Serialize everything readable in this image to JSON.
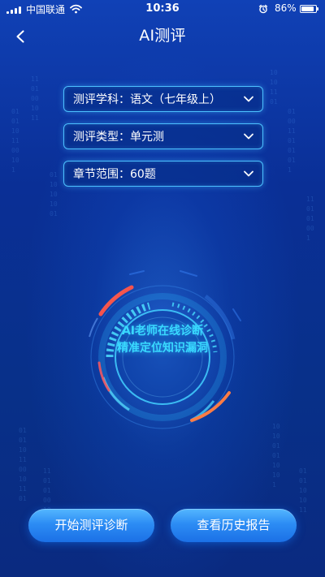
{
  "status_bar": {
    "carrier": "中国联通",
    "time": "10:36",
    "battery_percent": "86%",
    "battery_level": 0.86,
    "icons": [
      "signal-icon",
      "wifi-icon",
      "alarm-icon",
      "battery-icon"
    ]
  },
  "nav": {
    "back_icon": "back-arrow-icon",
    "title": "AI测评"
  },
  "selectors": [
    {
      "label": "测评学科：语文（七年级上）",
      "icon": "chevron-down-icon"
    },
    {
      "label": "测评类型：单元测",
      "icon": "chevron-down-icon"
    },
    {
      "label": "章节范围：60题",
      "icon": "chevron-down-icon"
    }
  ],
  "radar": {
    "line1": "AI老师在线诊断",
    "line2": "精准定位知识漏洞"
  },
  "actions": {
    "start_label": "开始测评诊断",
    "history_label": "查看历史报告"
  },
  "colors": {
    "background": "#0a2f92",
    "accent": "#39d9ff",
    "button": "#2c8cf4",
    "selector_border": "#4cc0ff",
    "warning_arc": "#ff704b"
  }
}
